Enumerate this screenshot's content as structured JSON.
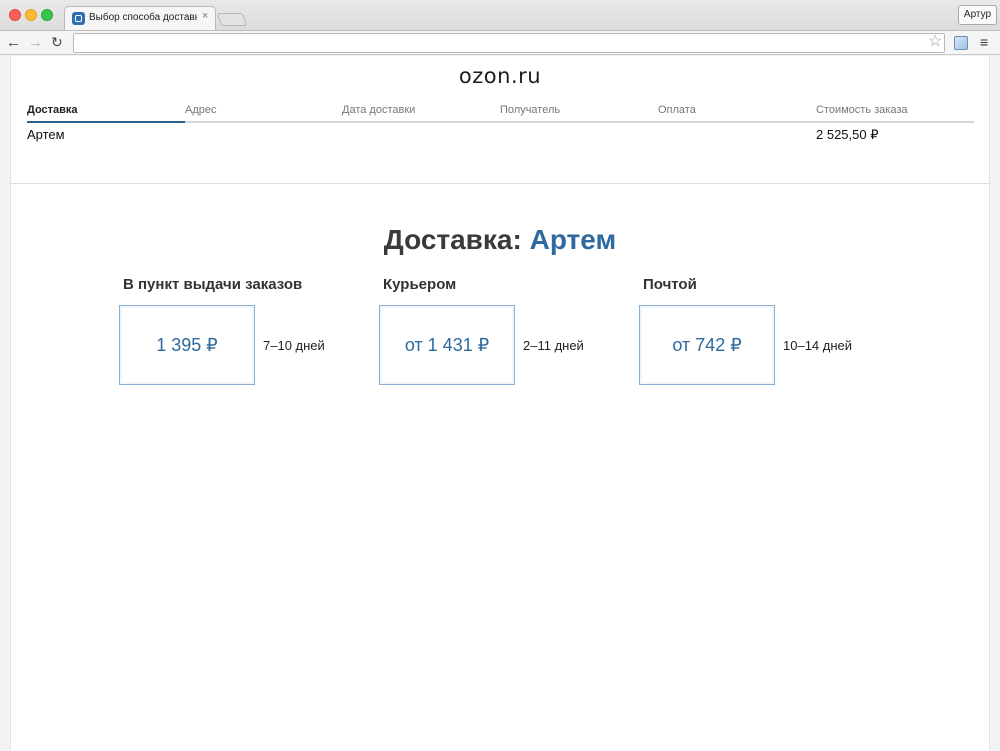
{
  "browser": {
    "tab_title": "Выбор способа доставки",
    "tab_close": "×",
    "profile": "Артур",
    "nav": {
      "back": "←",
      "forward": "→",
      "reload": "↻",
      "star": "☆",
      "menu": "≡"
    }
  },
  "site": {
    "logo": "ozon.ru"
  },
  "checkout_steps": [
    {
      "label": "Доставка",
      "active": true
    },
    {
      "label": "Адрес",
      "active": false
    },
    {
      "label": "Дата доставки",
      "active": false
    },
    {
      "label": "Получатель",
      "active": false
    },
    {
      "label": "Оплата",
      "active": false
    },
    {
      "label": "Стоимость заказа",
      "active": false
    }
  ],
  "summary": {
    "name": "Артем",
    "total": "2 525,50 ₽"
  },
  "heading": {
    "prefix": "Доставка:",
    "name": "Артем"
  },
  "delivery_options": [
    {
      "title": "В пункт выдачи заказов",
      "price": "1 395 ₽",
      "days": "7–10 дней"
    },
    {
      "title": "Курьером",
      "price": "от 1 431 ₽",
      "days": "2–11 дней"
    },
    {
      "title": "Почтой",
      "price": "от 742 ₽",
      "days": "10–14 дней"
    }
  ],
  "colors": {
    "accent": "#2f6a9e",
    "progress": "#2b628f"
  }
}
